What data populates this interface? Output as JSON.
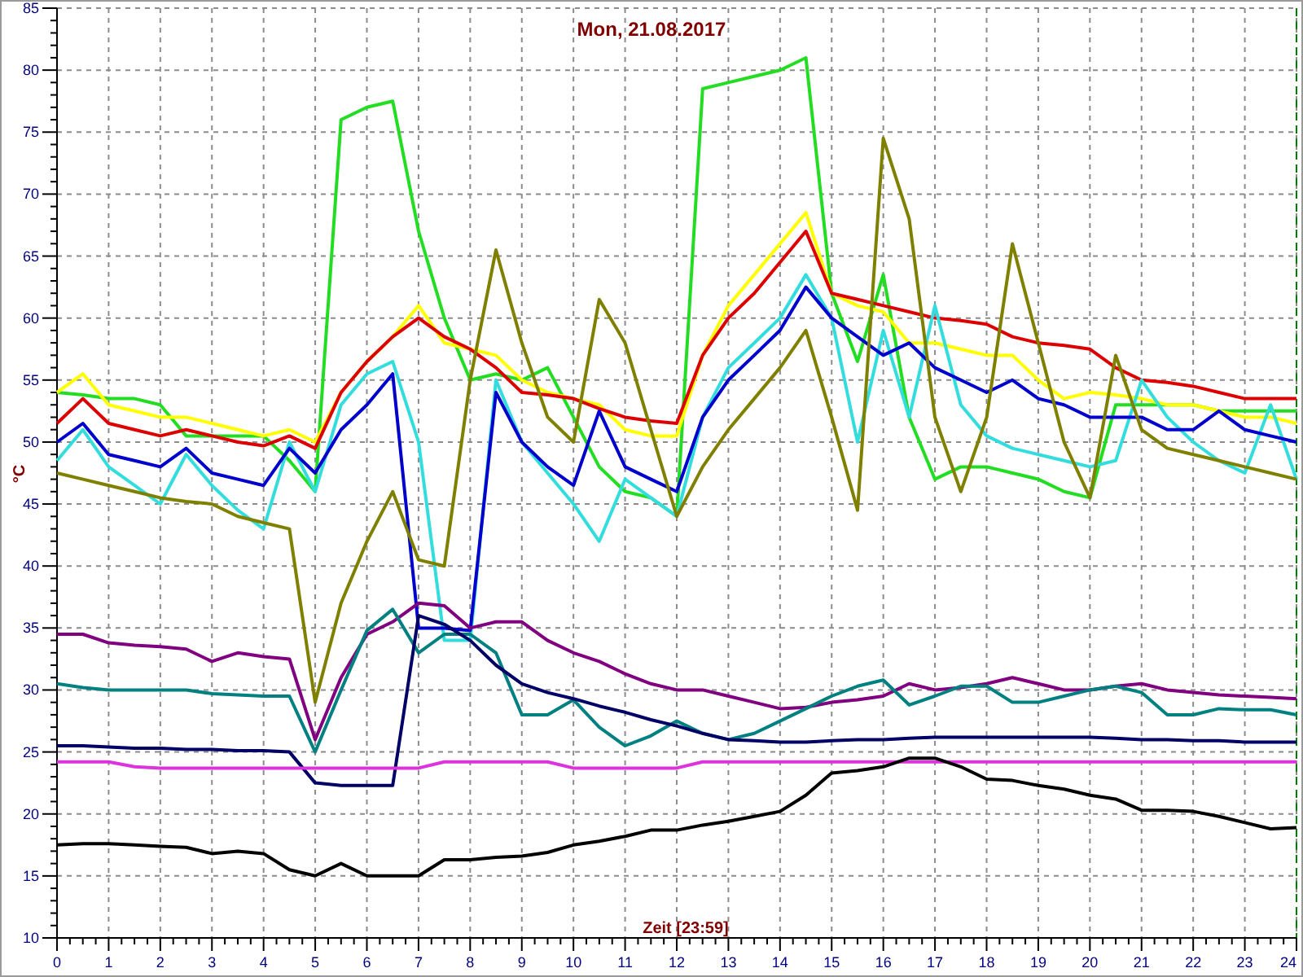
{
  "chart_data": {
    "type": "line",
    "grid": true,
    "title": "Mon, 21.08.2017",
    "xlabel": "Zeit [23:59]",
    "ylabel": "°C",
    "xlim": [
      0,
      24
    ],
    "ylim": [
      10,
      85
    ],
    "xticks": [
      0,
      1,
      2,
      3,
      4,
      5,
      6,
      7,
      8,
      9,
      10,
      11,
      12,
      13,
      14,
      15,
      16,
      17,
      18,
      19,
      20,
      21,
      22,
      23,
      24
    ],
    "yticks": [
      10,
      15,
      20,
      25,
      30,
      35,
      40,
      45,
      50,
      55,
      60,
      65,
      70,
      75,
      80,
      85
    ],
    "x": [
      0,
      0.5,
      1,
      1.5,
      2,
      2.5,
      3,
      3.5,
      4,
      4.5,
      5,
      5.5,
      6,
      6.5,
      7,
      7.5,
      8,
      8.5,
      9,
      9.5,
      10,
      10.5,
      11,
      11.5,
      12,
      12.5,
      13,
      13.5,
      14,
      14.5,
      15,
      15.5,
      16,
      16.5,
      17,
      17.5,
      18,
      18.5,
      19,
      19.5,
      20,
      20.5,
      21,
      21.5,
      22,
      22.5,
      23,
      23.5,
      24
    ],
    "series": [
      {
        "color": "#22dd22",
        "values": [
          54,
          53.8,
          53.5,
          53.5,
          53,
          50.5,
          50.5,
          50.5,
          50.5,
          48.5,
          46,
          76,
          77,
          77.5,
          67,
          60,
          55,
          55.5,
          55,
          56,
          52,
          48,
          46,
          45.5,
          44,
          78.5,
          79,
          79.5,
          80,
          81,
          62,
          56.5,
          63.5,
          52,
          47,
          48,
          48,
          47.5,
          47,
          46,
          45.5,
          53,
          53,
          53,
          53,
          52.5,
          52.5,
          52.5,
          52.5
        ]
      },
      {
        "color": "#ffff00",
        "values": [
          54,
          55.5,
          53,
          52.5,
          52,
          52,
          51.5,
          51,
          50.5,
          51,
          50,
          54,
          56.5,
          58.5,
          61,
          58,
          57.5,
          57,
          55,
          54,
          53.5,
          53,
          51,
          50.5,
          50.5,
          57,
          61,
          63.5,
          66,
          68.5,
          62,
          61,
          60.5,
          58,
          58,
          57.5,
          57,
          57,
          55,
          53.5,
          54,
          53.8,
          53.5,
          53,
          53,
          52.5,
          52,
          52,
          51.5
        ]
      },
      {
        "color": "#dd0000",
        "values": [
          51.5,
          53.5,
          51.5,
          51,
          50.5,
          51,
          50.5,
          50,
          49.7,
          50.5,
          49.5,
          54,
          56.5,
          58.5,
          60,
          58.5,
          57.5,
          56,
          54,
          53.8,
          53.5,
          52.7,
          52,
          51.7,
          51.5,
          57,
          60,
          62,
          64.5,
          67,
          62,
          61.5,
          61,
          60.5,
          60,
          59.8,
          59.5,
          58.5,
          58,
          57.8,
          57.5,
          56,
          55,
          54.8,
          54.5,
          54,
          53.5,
          53.5,
          53.5
        ]
      },
      {
        "color": "#33dddd",
        "values": [
          48.5,
          51,
          48,
          46.5,
          45,
          49,
          46.5,
          44.5,
          43,
          50,
          46,
          53,
          55.5,
          56.5,
          50,
          34,
          34,
          55,
          50,
          47.5,
          45,
          42,
          47,
          45.5,
          44,
          52,
          56,
          58,
          60,
          63.5,
          60,
          50,
          59,
          52,
          61,
          53,
          50.5,
          49.5,
          49,
          48.5,
          48,
          48.5,
          55,
          52,
          50,
          48.5,
          47.5,
          53,
          47
        ]
      },
      {
        "color": "#0000cc",
        "values": [
          50,
          51.5,
          49,
          48.5,
          48,
          49.5,
          47.5,
          47,
          46.5,
          49.5,
          47.5,
          51,
          53,
          55.5,
          35,
          35,
          34.8,
          54,
          50,
          48,
          46.5,
          52.5,
          48,
          47,
          46,
          52,
          55,
          57,
          59,
          62.5,
          60,
          58.5,
          57,
          58,
          56,
          55,
          54,
          55,
          53.5,
          53,
          52,
          52,
          52,
          51,
          51,
          52.5,
          51,
          50.5,
          50
        ]
      },
      {
        "color": "#808000",
        "values": [
          47.5,
          47,
          46.5,
          46,
          45.5,
          45.2,
          45,
          44,
          43.5,
          43,
          29,
          37,
          42,
          46,
          40.5,
          40,
          55,
          65.5,
          58,
          52,
          50,
          61.5,
          58,
          51,
          44,
          48,
          51,
          53.5,
          56,
          59,
          52,
          44.5,
          74.5,
          68,
          52,
          46,
          52,
          66,
          58,
          50,
          45.5,
          57,
          51,
          49.5,
          49,
          48.5,
          48,
          47.5,
          47
        ]
      },
      {
        "color": "#800080",
        "values": [
          34.5,
          34.5,
          33.8,
          33.6,
          33.5,
          33.3,
          32.3,
          33,
          32.7,
          32.5,
          26,
          31,
          34.5,
          35.5,
          37,
          36.8,
          35,
          35.5,
          35.5,
          34,
          33,
          32.3,
          31.3,
          30.5,
          30,
          30,
          29.5,
          29,
          28.5,
          28.6,
          29,
          29.2,
          29.5,
          30.5,
          30,
          30.2,
          30.5,
          31,
          30.5,
          30,
          30,
          30.3,
          30.5,
          30,
          29.8,
          29.6,
          29.5,
          29.4,
          29.3
        ]
      },
      {
        "color": "#008080",
        "values": [
          30.5,
          30.2,
          30,
          30,
          30,
          30,
          29.7,
          29.6,
          29.5,
          29.5,
          25,
          30,
          34.8,
          36.5,
          33,
          34.5,
          34.5,
          33,
          28,
          28,
          29.2,
          27,
          25.5,
          26.3,
          27.5,
          26.5,
          26,
          26.5,
          27.5,
          28.5,
          29.5,
          30.3,
          30.8,
          28.8,
          29.5,
          30.3,
          30.3,
          29,
          29,
          29.5,
          30,
          30.3,
          29.8,
          28,
          28,
          28.5,
          28.4,
          28.4,
          28
        ]
      },
      {
        "color": "#000066",
        "values": [
          25.5,
          25.5,
          25.4,
          25.3,
          25.3,
          25.2,
          25.2,
          25.1,
          25.1,
          25,
          22.5,
          22.3,
          22.3,
          22.3,
          36,
          35.3,
          34,
          32,
          30.5,
          29.8,
          29.3,
          28.7,
          28.2,
          27.6,
          27.1,
          26.5,
          26,
          25.9,
          25.8,
          25.8,
          25.9,
          26,
          26,
          26.1,
          26.2,
          26.2,
          26.2,
          26.2,
          26.2,
          26.2,
          26.2,
          26.1,
          26,
          26,
          25.9,
          25.9,
          25.8,
          25.8,
          25.8
        ]
      },
      {
        "color": "#dd33dd",
        "values": [
          24.2,
          24.2,
          24.2,
          23.8,
          23.7,
          23.7,
          23.7,
          23.7,
          23.7,
          23.7,
          23.7,
          23.7,
          23.7,
          23.7,
          23.7,
          24.2,
          24.2,
          24.2,
          24.2,
          24.2,
          23.7,
          23.7,
          23.7,
          23.7,
          23.7,
          24.2,
          24.2,
          24.2,
          24.2,
          24.2,
          24.2,
          24.2,
          24.2,
          24.2,
          24.2,
          24.2,
          24.2,
          24.2,
          24.2,
          24.2,
          24.2,
          24.2,
          24.2,
          24.2,
          24.2,
          24.2,
          24.2,
          24.2,
          24.2
        ]
      },
      {
        "color": "#000000",
        "values": [
          17.5,
          17.6,
          17.6,
          17.5,
          17.4,
          17.3,
          16.8,
          17,
          16.8,
          15.5,
          15,
          16,
          15,
          15,
          15,
          16.3,
          16.3,
          16.5,
          16.6,
          16.9,
          17.5,
          17.8,
          18.2,
          18.7,
          18.7,
          19.1,
          19.4,
          19.8,
          20.2,
          21.5,
          23.3,
          23.5,
          23.8,
          24.5,
          24.5,
          23.8,
          22.8,
          22.7,
          22.3,
          22,
          21.5,
          21.2,
          20.3,
          20.3,
          20.2,
          19.8,
          19.3,
          18.8,
          18.9
        ]
      }
    ]
  }
}
